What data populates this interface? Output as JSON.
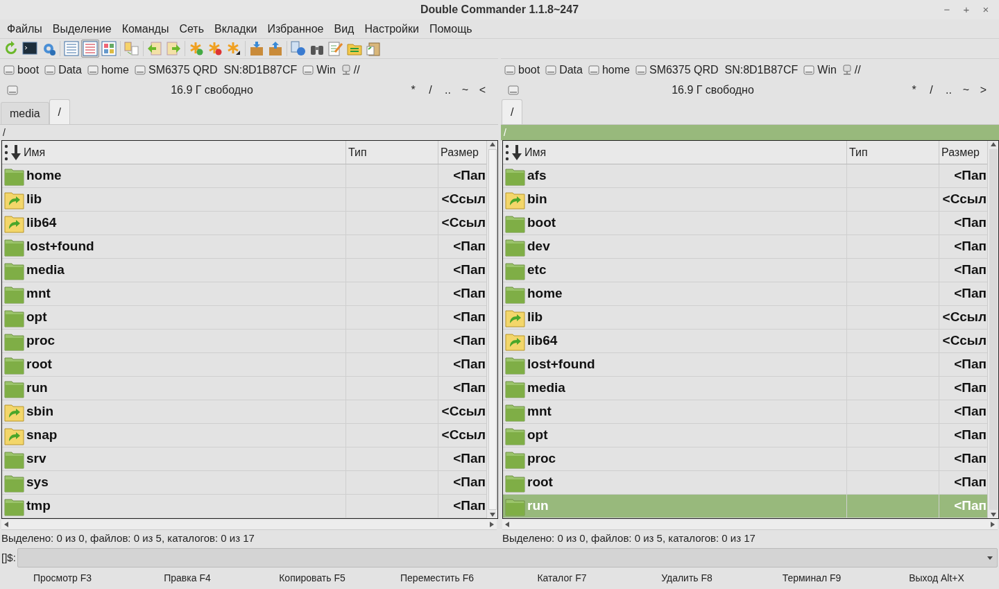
{
  "window": {
    "title": "Double Commander 1.1.8~247",
    "controls": [
      "−",
      "+",
      "×"
    ]
  },
  "menu": [
    "Файлы",
    "Выделение",
    "Команды",
    "Сеть",
    "Вкладки",
    "Избранное",
    "Вид",
    "Настройки",
    "Помощь"
  ],
  "toolbar": [
    {
      "selected": false
    },
    {
      "selected": false
    },
    {
      "selected": false
    },
    {
      "selected": false
    },
    {
      "selected": true
    },
    {
      "selected": false
    },
    {
      "selected": false
    },
    {
      "selected": false
    },
    {
      "selected": false
    },
    {
      "selected": false
    },
    {
      "selected": false
    },
    {
      "selected": false
    },
    {
      "selected": false
    },
    {
      "selected": false
    },
    {
      "selected": false
    },
    {
      "selected": false
    },
    {
      "selected": false
    },
    {
      "selected": false
    },
    {
      "selected": false
    }
  ],
  "panels": [
    {
      "active": false,
      "drives": [
        {
          "label": "boot",
          "kind": "disk"
        },
        {
          "label": "Data",
          "kind": "disk"
        },
        {
          "label": "home",
          "kind": "disk"
        },
        {
          "label": "SM6375 QRD  SN:8D1B87CF",
          "kind": "disk"
        },
        {
          "label": "Win",
          "kind": "disk"
        },
        {
          "label": "//",
          "kind": "network"
        }
      ],
      "free_space": "16.9 Г свободно",
      "nav": [
        "*",
        "/",
        "..",
        "~",
        "<"
      ],
      "tabs": [
        {
          "label": "media",
          "selected": false
        },
        {
          "label": "/",
          "selected": true
        }
      ],
      "path": "/",
      "columns": [
        "Имя",
        "Тип",
        "Размер"
      ],
      "rows": [
        {
          "name": "home",
          "kind": "folder",
          "size": "<Пап",
          "selected": false
        },
        {
          "name": "lib",
          "kind": "link",
          "size": "<Ссыл",
          "selected": false
        },
        {
          "name": "lib64",
          "kind": "link",
          "size": "<Ссыл",
          "selected": false
        },
        {
          "name": "lost+found",
          "kind": "folder",
          "size": "<Пап",
          "selected": false
        },
        {
          "name": "media",
          "kind": "folder",
          "size": "<Пап",
          "selected": false
        },
        {
          "name": "mnt",
          "kind": "folder",
          "size": "<Пап",
          "selected": false
        },
        {
          "name": "opt",
          "kind": "folder",
          "size": "<Пап",
          "selected": false
        },
        {
          "name": "proc",
          "kind": "folder",
          "size": "<Пап",
          "selected": false
        },
        {
          "name": "root",
          "kind": "folder",
          "size": "<Пап",
          "selected": false
        },
        {
          "name": "run",
          "kind": "folder",
          "size": "<Пап",
          "selected": false
        },
        {
          "name": "sbin",
          "kind": "link",
          "size": "<Ссыл",
          "selected": false
        },
        {
          "name": "snap",
          "kind": "link",
          "size": "<Ссыл",
          "selected": false
        },
        {
          "name": "srv",
          "kind": "folder",
          "size": "<Пап",
          "selected": false
        },
        {
          "name": "sys",
          "kind": "folder",
          "size": "<Пап",
          "selected": false
        },
        {
          "name": "tmp",
          "kind": "folder",
          "size": "<Пап",
          "selected": false
        }
      ],
      "status": "Выделено: 0 из 0, файлов: 0 из 5, каталогов: 0 из 17"
    },
    {
      "active": true,
      "drives": [
        {
          "label": "boot",
          "kind": "disk"
        },
        {
          "label": "Data",
          "kind": "disk"
        },
        {
          "label": "home",
          "kind": "disk"
        },
        {
          "label": "SM6375 QRD  SN:8D1B87CF",
          "kind": "disk"
        },
        {
          "label": "Win",
          "kind": "disk"
        },
        {
          "label": "//",
          "kind": "network"
        }
      ],
      "free_space": "16.9 Г свободно",
      "nav": [
        "*",
        "/",
        "..",
        "~",
        ">"
      ],
      "tabs": [
        {
          "label": "/",
          "selected": true
        }
      ],
      "path": "/",
      "columns": [
        "Имя",
        "Тип",
        "Размер"
      ],
      "rows": [
        {
          "name": "afs",
          "kind": "folder",
          "size": "<Пап",
          "selected": false
        },
        {
          "name": "bin",
          "kind": "link",
          "size": "<Ссыл",
          "selected": false
        },
        {
          "name": "boot",
          "kind": "folder",
          "size": "<Пап",
          "selected": false
        },
        {
          "name": "dev",
          "kind": "folder",
          "size": "<Пап",
          "selected": false
        },
        {
          "name": "etc",
          "kind": "folder",
          "size": "<Пап",
          "selected": false
        },
        {
          "name": "home",
          "kind": "folder",
          "size": "<Пап",
          "selected": false
        },
        {
          "name": "lib",
          "kind": "link",
          "size": "<Ссыл",
          "selected": false
        },
        {
          "name": "lib64",
          "kind": "link",
          "size": "<Ссыл",
          "selected": false
        },
        {
          "name": "lost+found",
          "kind": "folder",
          "size": "<Пап",
          "selected": false
        },
        {
          "name": "media",
          "kind": "folder",
          "size": "<Пап",
          "selected": false
        },
        {
          "name": "mnt",
          "kind": "folder",
          "size": "<Пап",
          "selected": false
        },
        {
          "name": "opt",
          "kind": "folder",
          "size": "<Пап",
          "selected": false
        },
        {
          "name": "proc",
          "kind": "folder",
          "size": "<Пап",
          "selected": false
        },
        {
          "name": "root",
          "kind": "folder",
          "size": "<Пап",
          "selected": false
        },
        {
          "name": "run",
          "kind": "folder",
          "size": "<Пап",
          "selected": true
        }
      ],
      "status": "Выделено: 0 из 0, файлов: 0 из 5, каталогов: 0 из 17"
    }
  ],
  "command_line": {
    "prompt": "[]$:"
  },
  "function_keys": [
    "Просмотр F3",
    "Правка F4",
    "Копировать F5",
    "Переместить F6",
    "Каталог F7",
    "Удалить F8",
    "Терминал F9",
    "Выход Alt+X"
  ]
}
